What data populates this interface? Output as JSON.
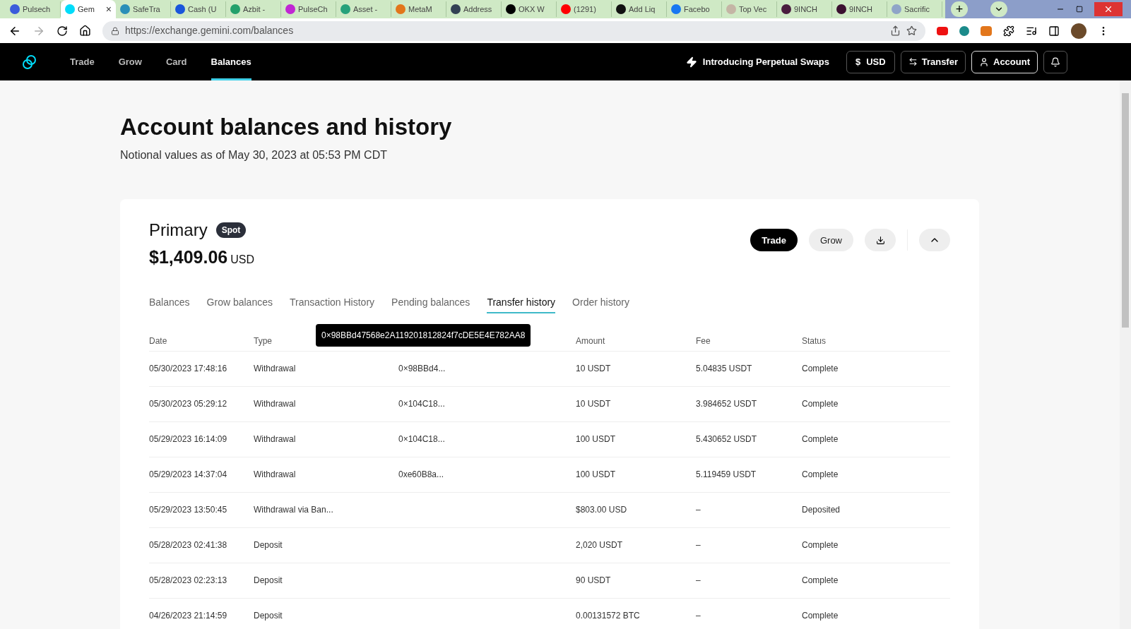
{
  "browser": {
    "tabs": [
      {
        "title": "Pulsech",
        "selected": false,
        "color": "#3b5bdb"
      },
      {
        "title": "Gem",
        "selected": true,
        "color": "#00dcfa"
      },
      {
        "title": "SafeTra",
        "selected": false,
        "color": "#2a8fb8"
      },
      {
        "title": "Cash (U",
        "selected": false,
        "color": "#1a56db"
      },
      {
        "title": "Azbit -",
        "selected": false,
        "color": "#22a06b"
      },
      {
        "title": "PulseCh",
        "selected": false,
        "color": "#c026d3"
      },
      {
        "title": "Asset -",
        "selected": false,
        "color": "#26a17b"
      },
      {
        "title": "MetaM",
        "selected": false,
        "color": "#e2761b"
      },
      {
        "title": "Address",
        "selected": false,
        "color": "#334155"
      },
      {
        "title": "OKX W",
        "selected": false,
        "color": "#000000"
      },
      {
        "title": "(1291)",
        "selected": false,
        "color": "#ff0000"
      },
      {
        "title": "Add Liq",
        "selected": false,
        "color": "#111111"
      },
      {
        "title": "Facebo",
        "selected": false,
        "color": "#1877f2"
      },
      {
        "title": "Top Vec",
        "selected": false,
        "color": "#c4b5a5"
      },
      {
        "title": "9INCH",
        "selected": false,
        "color": "#4a1d3f"
      },
      {
        "title": "9INCH",
        "selected": false,
        "color": "#3b1030"
      },
      {
        "title": "Sacrific",
        "selected": false,
        "color": "#8fa4c8"
      }
    ],
    "close": "×",
    "new_tab": "+",
    "url": "https://exchange.gemini.com/balances"
  },
  "nav": {
    "items": [
      {
        "label": "Trade",
        "selected": false
      },
      {
        "label": "Grow",
        "selected": false
      },
      {
        "label": "Card",
        "selected": false
      },
      {
        "label": "Balances",
        "selected": true
      }
    ],
    "promo": "Introducing Perpetual Swaps",
    "currency_symbol": "$",
    "currency": "USD",
    "transfer": "Transfer",
    "account": "Account"
  },
  "heading": "Account balances and history",
  "subheading": "Notional values as of May 30, 2023 at 05:53 PM CDT",
  "account": {
    "name": "Primary",
    "badge": "Spot",
    "balance": "$1,409.06",
    "balance_unit": "USD",
    "trade": "Trade",
    "grow": "Grow"
  },
  "tabs": [
    {
      "label": "Balances",
      "selected": false
    },
    {
      "label": "Grow balances",
      "selected": false
    },
    {
      "label": "Transaction History",
      "selected": false
    },
    {
      "label": "Pending balances",
      "selected": false
    },
    {
      "label": "Transfer history",
      "selected": true
    },
    {
      "label": "Order history",
      "selected": false
    }
  ],
  "table": {
    "columns": [
      "Date",
      "Type",
      "",
      "Amount",
      "Fee",
      "Status"
    ],
    "tooltip": "0×98BBd47568e2A119201812824f7cDE5E4E782AA8",
    "rows": [
      [
        "05/30/2023 17:48:16",
        "Withdrawal",
        "0×98BBd4...",
        "10 USDT",
        "5.04835 USDT",
        "Complete"
      ],
      [
        "05/30/2023 05:29:12",
        "Withdrawal",
        "0×104C18...",
        "10 USDT",
        "3.984652 USDT",
        "Complete"
      ],
      [
        "05/29/2023 16:14:09",
        "Withdrawal",
        "0×104C18...",
        "100 USDT",
        "5.430652 USDT",
        "Complete"
      ],
      [
        "05/29/2023 14:37:04",
        "Withdrawal",
        "0xe60B8a...",
        "100 USDT",
        "5.119459 USDT",
        "Complete"
      ],
      [
        "05/29/2023 13:50:45",
        "Withdrawal via Ban...",
        "",
        "$803.00 USD",
        "–",
        "Deposited"
      ],
      [
        "05/28/2023 02:41:38",
        "Deposit",
        "",
        "2,020 USDT",
        "–",
        "Complete"
      ],
      [
        "05/28/2023 02:23:13",
        "Deposit",
        "",
        "90 USDT",
        "–",
        "Complete"
      ],
      [
        "04/26/2023 21:14:59",
        "Deposit",
        "",
        "0.00131572 BTC",
        "–",
        "Complete"
      ]
    ]
  }
}
